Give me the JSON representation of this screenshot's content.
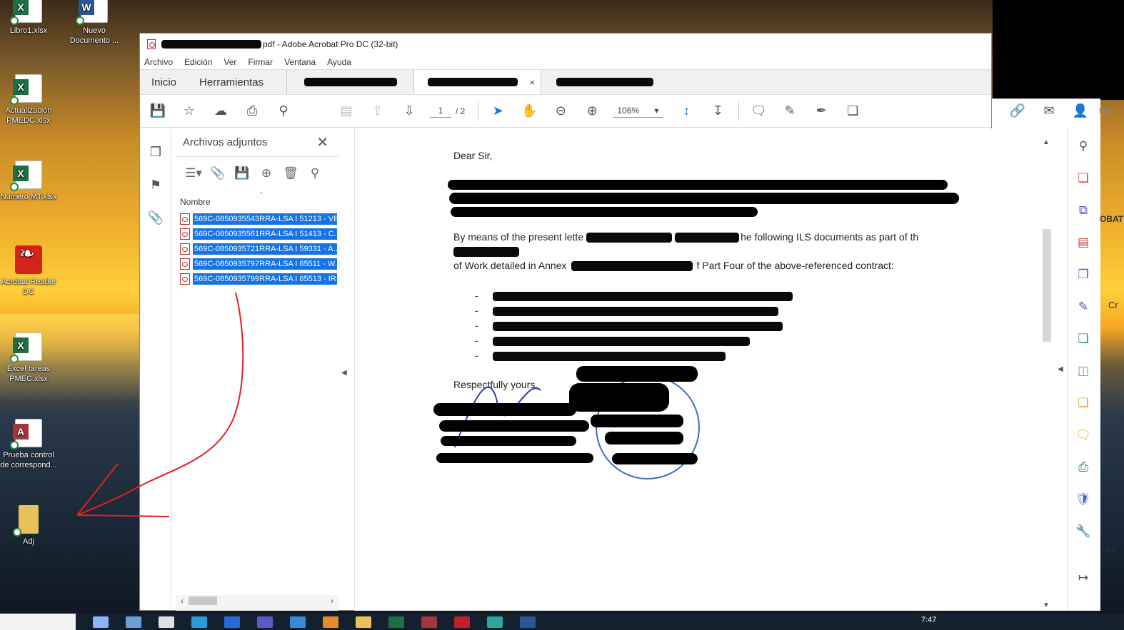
{
  "desktop": {
    "icons": [
      {
        "label": "Libro1.xlsx",
        "type": "excel"
      },
      {
        "label": "Nuevo Documento ...",
        "type": "word"
      },
      {
        "label": "Actualización PMEDC.xlsx",
        "type": "excel"
      },
      {
        "label": "Numero MT.xlsx",
        "type": "excel"
      },
      {
        "label": "Acrobat Reader DC",
        "type": "acrobat"
      },
      {
        "label": "Excel tareas PMEC.xlsx",
        "type": "excel"
      },
      {
        "label": "Prueba control de correspond...",
        "type": "access"
      },
      {
        "label": "Adj",
        "type": "folder"
      }
    ]
  },
  "window": {
    "title_suffix": "pdf - Adobe Acrobat Pro DC (32-bit)",
    "menu": [
      "Archivo",
      "Edición",
      "Ver",
      "Firmar",
      "Ventana",
      "Ayuda"
    ],
    "tabs": {
      "home": "Inicio",
      "tools": "Herramientas",
      "close": "×"
    },
    "toolbar": {
      "page_current": "1",
      "page_total": "/ 2",
      "zoom": "106%"
    }
  },
  "attachments": {
    "title": "Archivos adjuntos",
    "close": "✕",
    "column": "Nombre",
    "files": [
      "569C-0850935543RRA-LSA I 51213 - VE",
      "569C-0850935561RRA-LSA I 51413 - C...",
      "569C-0850935721RRA-LSA I 59331 - A...",
      "569C-0850935797RRA-LSA I 65511 - W...",
      "569C-0850935799RRA-LSA I 65513 - IR..."
    ]
  },
  "document": {
    "greeting": "Dear Sir,",
    "para2_a": "By means of the present lette",
    "para2_b": "he following ILS documents as part of th",
    "para2_c": "of Work detailed in Annex",
    "para2_d": "f Part Four of the above-referenced contract:",
    "bullet": "-",
    "closing": "Respectfully yours,"
  },
  "right_edge": {
    "text1": "nge",
    "text2": "OBAT",
    "text3": "Cr",
    "text4": "icen"
  },
  "taskbar": {
    "time": "7:47"
  },
  "colors": {
    "accent": "#1473e6",
    "annotation": "#e02020"
  }
}
